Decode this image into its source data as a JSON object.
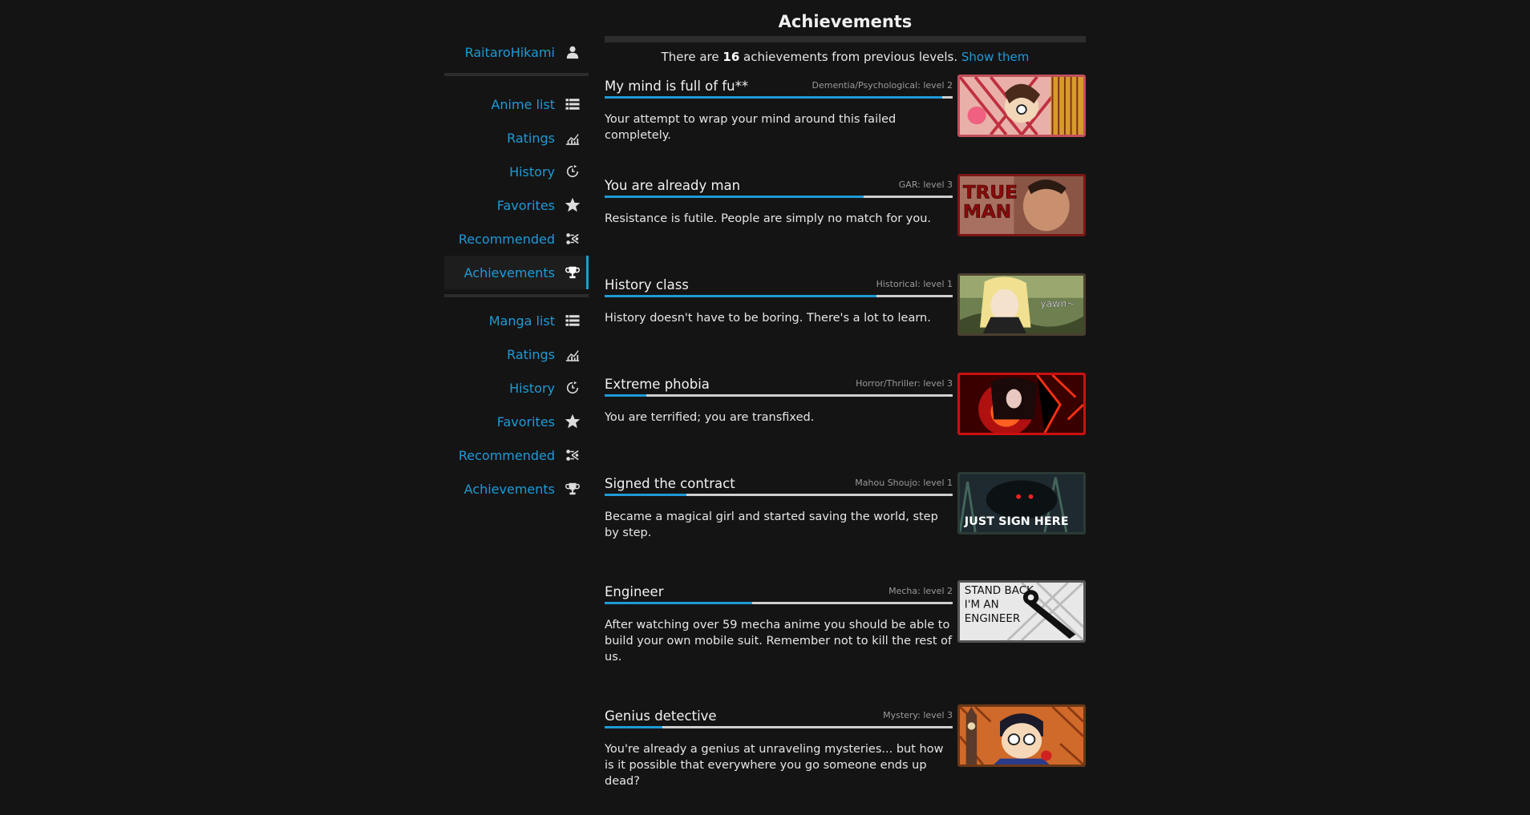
{
  "sidebar": {
    "user": {
      "label": "RaitaroHikami",
      "icon": "user-icon"
    },
    "anime": [
      {
        "label": "Anime list",
        "icon": "list-icon"
      },
      {
        "label": "Ratings",
        "icon": "chart-icon"
      },
      {
        "label": "History",
        "icon": "clock-icon"
      },
      {
        "label": "Favorites",
        "icon": "star-icon"
      },
      {
        "label": "Recommended",
        "icon": "recommend-icon"
      },
      {
        "label": "Achievements",
        "icon": "trophy-icon",
        "active": true
      }
    ],
    "manga": [
      {
        "label": "Manga list",
        "icon": "list-icon"
      },
      {
        "label": "Ratings",
        "icon": "chart-icon"
      },
      {
        "label": "History",
        "icon": "clock-icon"
      },
      {
        "label": "Favorites",
        "icon": "star-icon"
      },
      {
        "label": "Recommended",
        "icon": "recommend-icon"
      },
      {
        "label": "Achievements",
        "icon": "trophy-icon"
      }
    ]
  },
  "main": {
    "title": "Achievements",
    "previous": {
      "prefix": "There are ",
      "count": "16",
      "suffix": " achievements from previous levels. ",
      "link": "Show them"
    }
  },
  "achievements": [
    {
      "name": "My mind is full of fu**",
      "level": "Dementia/Psychological: level 2",
      "progress": 0.97,
      "description": "Your attempt to wrap your mind around this failed completely.",
      "border": "#c0505c"
    },
    {
      "name": "You are already man",
      "level": "GAR: level 3",
      "progress": 0.745,
      "description": "Resistance is futile. People are simply no match for you.",
      "border": "#7a1616",
      "image_text": "TRUE MAN"
    },
    {
      "name": "History class",
      "level": "Historical: level 1",
      "progress": 0.78,
      "description": "History doesn't have to be boring. There's a lot to learn.",
      "border": "#4a4030",
      "image_text": "yawn~"
    },
    {
      "name": "Extreme phobia",
      "level": "Horror/Thriller: level 3",
      "progress": 0.12,
      "description": "You are terrified; you are transfixed.",
      "border": "#cc1010"
    },
    {
      "name": "Signed the contract",
      "level": "Mahou Shoujo: level 1",
      "progress": 0.235,
      "description": "Became a magical girl and started saving the world, step by step.",
      "border": "#2b3a35",
      "image_text": "JUST SIGN HERE"
    },
    {
      "name": "Engineer",
      "level": "Mecha: level 2",
      "progress": 0.425,
      "description": "After watching over 59 mecha anime you should be able to build your own mobile suit. Remember not to kill the rest of us.",
      "border": "#555555",
      "image_text": "STAND BACK I'M AN ENGINEER"
    },
    {
      "name": "Genius detective",
      "level": "Mystery: level 3",
      "progress": 0.165,
      "description": "You're already a genius at unraveling mysteries... but how is it possible that everywhere you go someone ends up dead?",
      "border": "#6a3818"
    }
  ]
}
